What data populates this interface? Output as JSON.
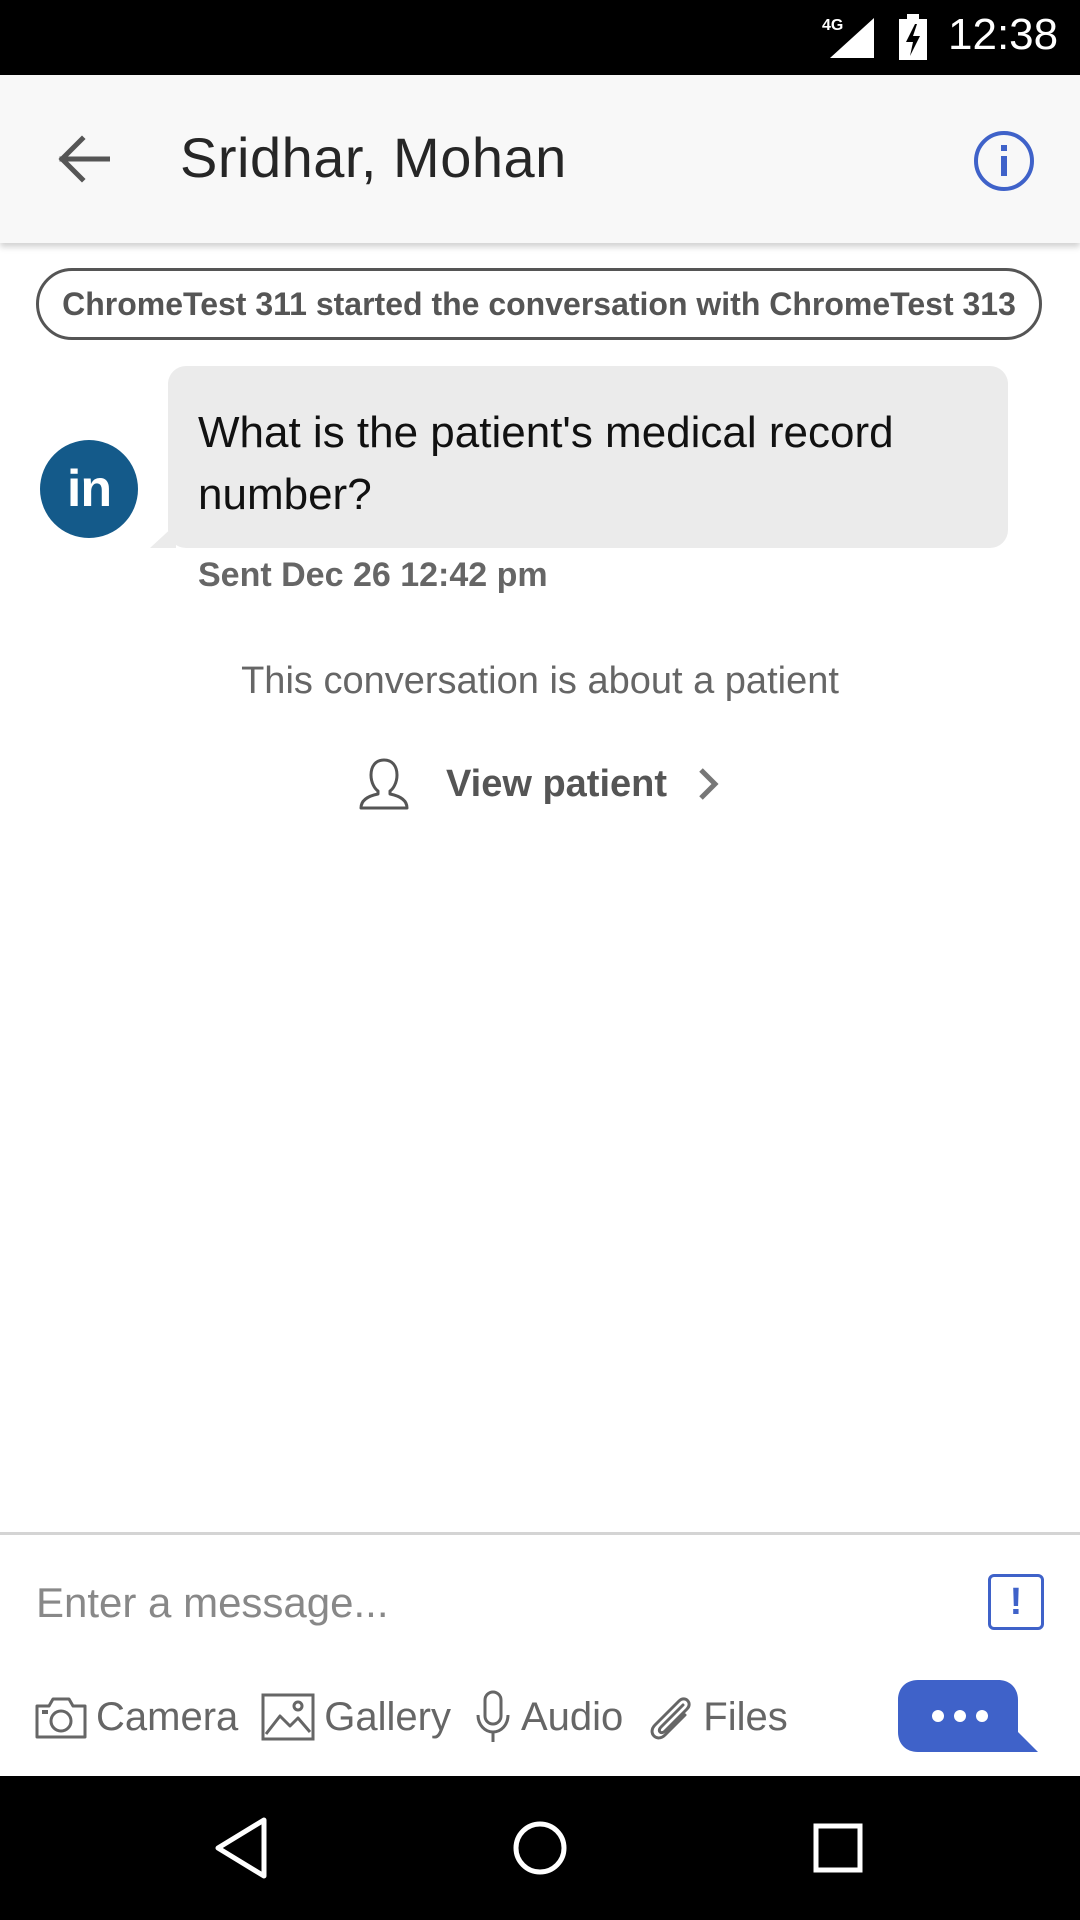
{
  "status_bar": {
    "network": "4G",
    "time": "12:38"
  },
  "header": {
    "title": "Sridhar, Mohan"
  },
  "conversation": {
    "system_message": "ChromeTest 311 started the conversation with ChromeTest 313",
    "avatar_text": "in",
    "messages": [
      {
        "text": "What is the patient's medical record number?",
        "timestamp": "Sent Dec 26 12:42 pm"
      }
    ],
    "about_text": "This conversation is about a patient",
    "view_patient_label": "View patient"
  },
  "composer": {
    "placeholder": "Enter a message...",
    "priority_label": "!",
    "attachments": [
      {
        "label": "Camera",
        "icon": "camera-icon"
      },
      {
        "label": "Gallery",
        "icon": "gallery-icon"
      },
      {
        "label": "Audio",
        "icon": "microphone-icon"
      },
      {
        "label": "Files",
        "icon": "paperclip-icon"
      }
    ]
  },
  "colors": {
    "accent": "#3f62c9",
    "avatar_bg": "#145a8a",
    "bubble_bg": "#ebebeb"
  }
}
